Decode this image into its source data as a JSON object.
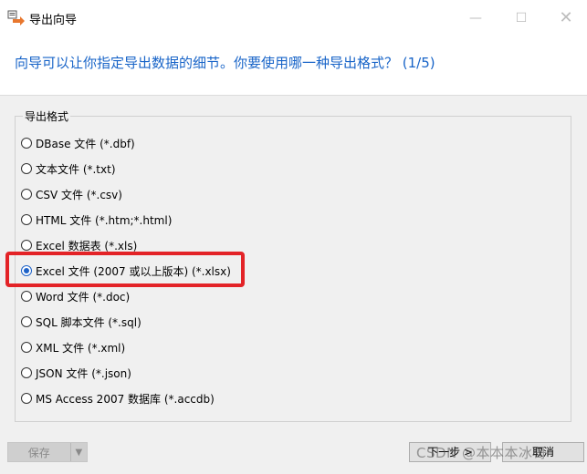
{
  "window": {
    "title": "导出向导",
    "min_glyph": "—",
    "max_glyph": "☐",
    "close_glyph": "✕"
  },
  "header": {
    "question": "向导可以让你指定导出数据的细节。你要使用哪一种导出格式？ (1/5)"
  },
  "group": {
    "title": "导出格式",
    "options": [
      {
        "label": "DBase 文件 (*.dbf)",
        "checked": false
      },
      {
        "label": "文本文件 (*.txt)",
        "checked": false
      },
      {
        "label": "CSV 文件 (*.csv)",
        "checked": false
      },
      {
        "label": "HTML 文件 (*.htm;*.html)",
        "checked": false
      },
      {
        "label": "Excel 数据表 (*.xls)",
        "checked": false
      },
      {
        "label": "Excel 文件 (2007 或以上版本) (*.xlsx)",
        "checked": true
      },
      {
        "label": "Word 文件 (*.doc)",
        "checked": false
      },
      {
        "label": "SQL 脚本文件 (*.sql)",
        "checked": false
      },
      {
        "label": "XML 文件 (*.xml)",
        "checked": false
      },
      {
        "label": "JSON 文件 (*.json)",
        "checked": false
      },
      {
        "label": "MS Access 2007 数据库 (*.accdb)",
        "checked": false
      }
    ]
  },
  "footer": {
    "save_label": "保存",
    "save_arrow": "▼",
    "next_label": "下一步 >",
    "cancel_label": "取消"
  },
  "watermark": "CSDN @本本本冰哥",
  "colors": {
    "accent": "#1864c8",
    "highlight": "#e32327"
  }
}
